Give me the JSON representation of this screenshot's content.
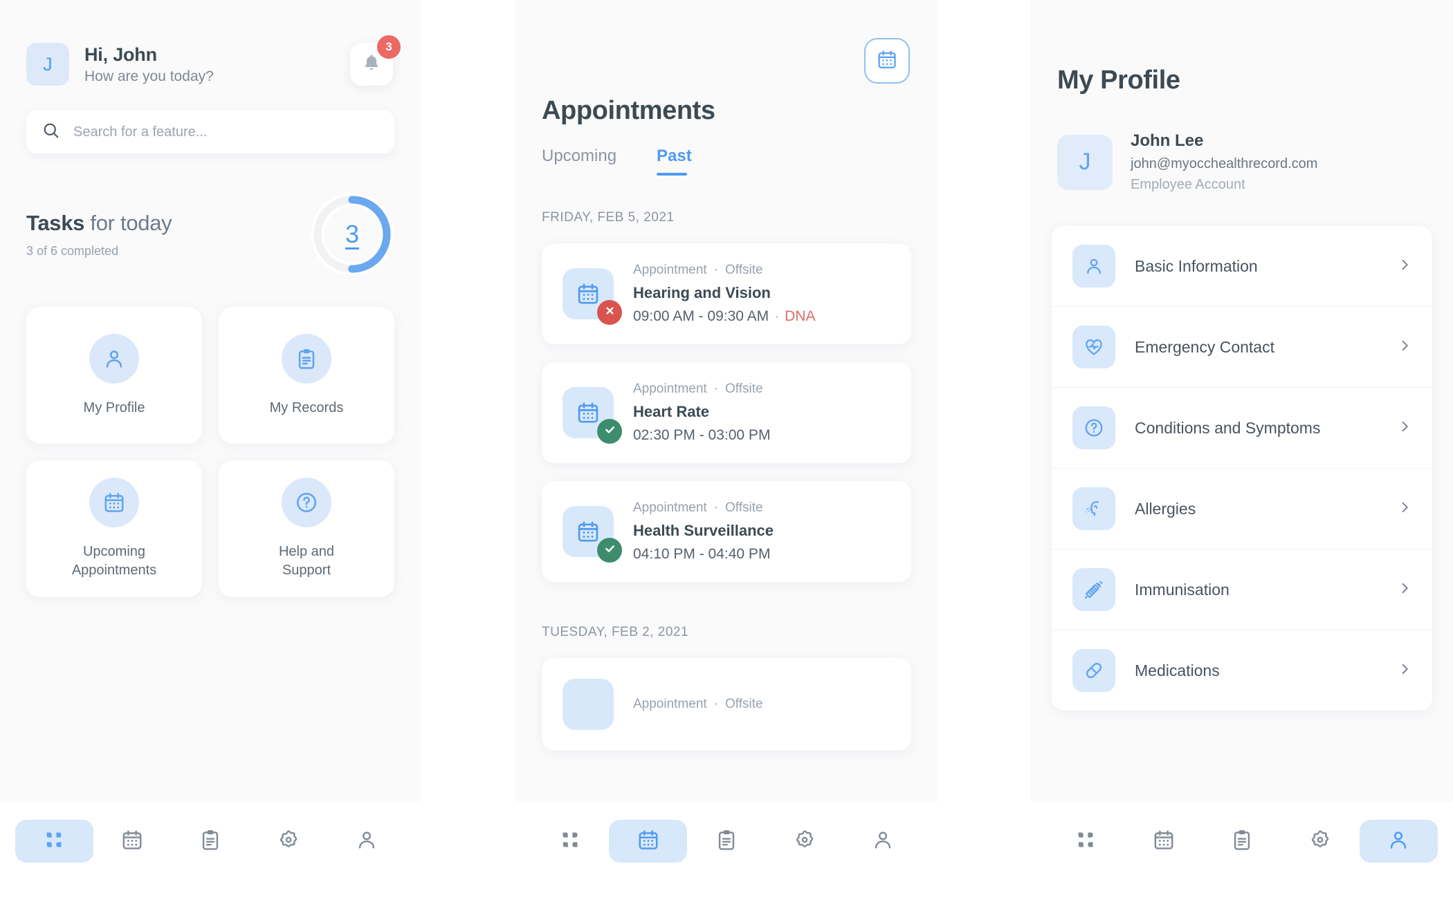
{
  "home": {
    "avatar_initial": "J",
    "greeting": "Hi, John",
    "greeting_sub": "How are you today?",
    "notification_count": "3",
    "search_placeholder": "Search for a feature...",
    "tasks": {
      "title_bold": "Tasks",
      "title_rest": " for today",
      "subtitle": "3 of 6 completed",
      "completed": "3",
      "total": "6",
      "ring_value": "3",
      "ring_percent": 50
    },
    "features": [
      {
        "label": "My Profile",
        "icon": "user-icon"
      },
      {
        "label": "My Records",
        "icon": "clipboard-icon"
      },
      {
        "label": "Upcoming\nAppointments",
        "label_line1": "Upcoming",
        "label_line2": "Appointments",
        "icon": "calendar-icon"
      },
      {
        "label": "Help and\nSupport",
        "label_line1": "Help and",
        "label_line2": "Support",
        "icon": "help-circle-icon"
      }
    ]
  },
  "appointments": {
    "title": "Appointments",
    "calendar_button_icon": "calendar-icon",
    "tabs": [
      {
        "label": "Upcoming",
        "active": false
      },
      {
        "label": "Past",
        "active": true
      }
    ],
    "groups": [
      {
        "day_label": "FRIDAY, FEB 5, 2021",
        "items": [
          {
            "kind": "Appointment",
            "location": "Offsite",
            "name": "Hearing and Vision",
            "time": "09:00 AM - 09:30 AM",
            "status": "DNA",
            "badge": "cancel"
          },
          {
            "kind": "Appointment",
            "location": "Offsite",
            "name": "Heart Rate",
            "time": "02:30 PM - 03:00 PM",
            "status": "",
            "badge": "done"
          },
          {
            "kind": "Appointment",
            "location": "Offsite",
            "name": "Health Surveillance",
            "time": "04:10 PM - 04:40 PM",
            "status": "",
            "badge": "done"
          }
        ]
      },
      {
        "day_label": "TUESDAY, FEB 2, 2021",
        "items": []
      }
    ]
  },
  "profile": {
    "title": "My Profile",
    "avatar_initial": "J",
    "name": "John Lee",
    "email": "john@myocchealthrecord.com",
    "account_type": "Employee Account",
    "items": [
      {
        "label": "Basic Information",
        "icon": "user-icon"
      },
      {
        "label": "Emergency Contact",
        "icon": "heart-pulse-icon"
      },
      {
        "label": "Conditions and Symptoms",
        "icon": "help-circle-icon"
      },
      {
        "label": "Allergies",
        "icon": "allergy-head-icon"
      },
      {
        "label": "Immunisation",
        "icon": "syringe-icon"
      },
      {
        "label": "Medications",
        "icon": "pill-icon"
      }
    ]
  },
  "nav": {
    "items": [
      {
        "icon": "grid-icon"
      },
      {
        "icon": "calendar-icon"
      },
      {
        "icon": "clipboard-icon"
      },
      {
        "icon": "gear-icon"
      },
      {
        "icon": "user-icon"
      }
    ],
    "active_home": 0,
    "active_appointments": 1,
    "active_profile": 4
  },
  "colors": {
    "accent": "#4f9bf0",
    "accent_soft": "#d8e8fb",
    "text_dark": "#3c4a54",
    "text_muted": "#8b95a1",
    "danger": "#d9534f",
    "success": "#3d8d6d",
    "badge_red": "#ec6a63",
    "page_bg": "#fafafb"
  }
}
